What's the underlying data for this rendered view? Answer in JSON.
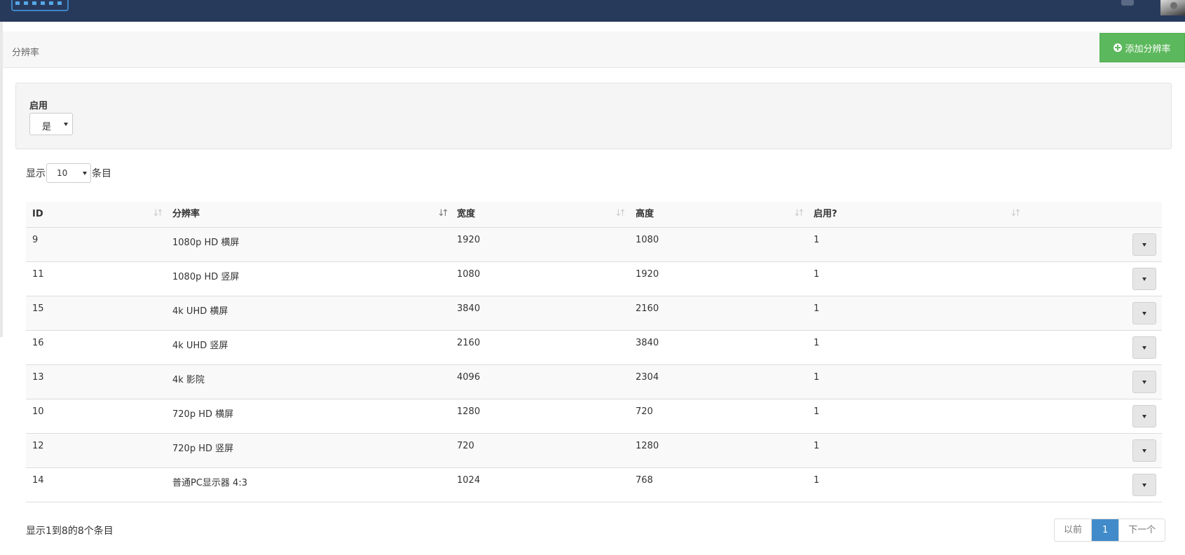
{
  "page": {
    "title": "分辨率",
    "add_button": "添加分辨率"
  },
  "filter": {
    "label": "启用",
    "value": "是"
  },
  "length": {
    "prefix": "显示",
    "value": "10",
    "suffix": "条目"
  },
  "table": {
    "columns": [
      "ID",
      "分辨率",
      "宽度",
      "高度",
      "启用?"
    ],
    "rows": [
      [
        "9",
        "1080p HD 横屏",
        "1920",
        "1080",
        "1"
      ],
      [
        "11",
        "1080p HD 竖屏",
        "1080",
        "1920",
        "1"
      ],
      [
        "15",
        "4k UHD 横屏",
        "3840",
        "2160",
        "1"
      ],
      [
        "16",
        "4k UHD 竖屏",
        "2160",
        "3840",
        "1"
      ],
      [
        "13",
        "4k 影院",
        "4096",
        "2304",
        "1"
      ],
      [
        "10",
        "720p HD 横屏",
        "1280",
        "720",
        "1"
      ],
      [
        "12",
        "720p HD 竖屏",
        "720",
        "1280",
        "1"
      ],
      [
        "14",
        "普通PC显示器 4:3",
        "1024",
        "768",
        "1"
      ]
    ]
  },
  "footer": {
    "info": "显示1到8的8个条目",
    "prev": "以前",
    "page": "1",
    "next": "下一个"
  },
  "icons": {
    "add": "plus-circle-icon",
    "notify": "bell-icon",
    "user": "avatar",
    "row_action": "caret-down-icon"
  },
  "colors": {
    "topbar": "#283a5c",
    "add_button": "#5cb85c",
    "pager_active": "#428bca"
  }
}
